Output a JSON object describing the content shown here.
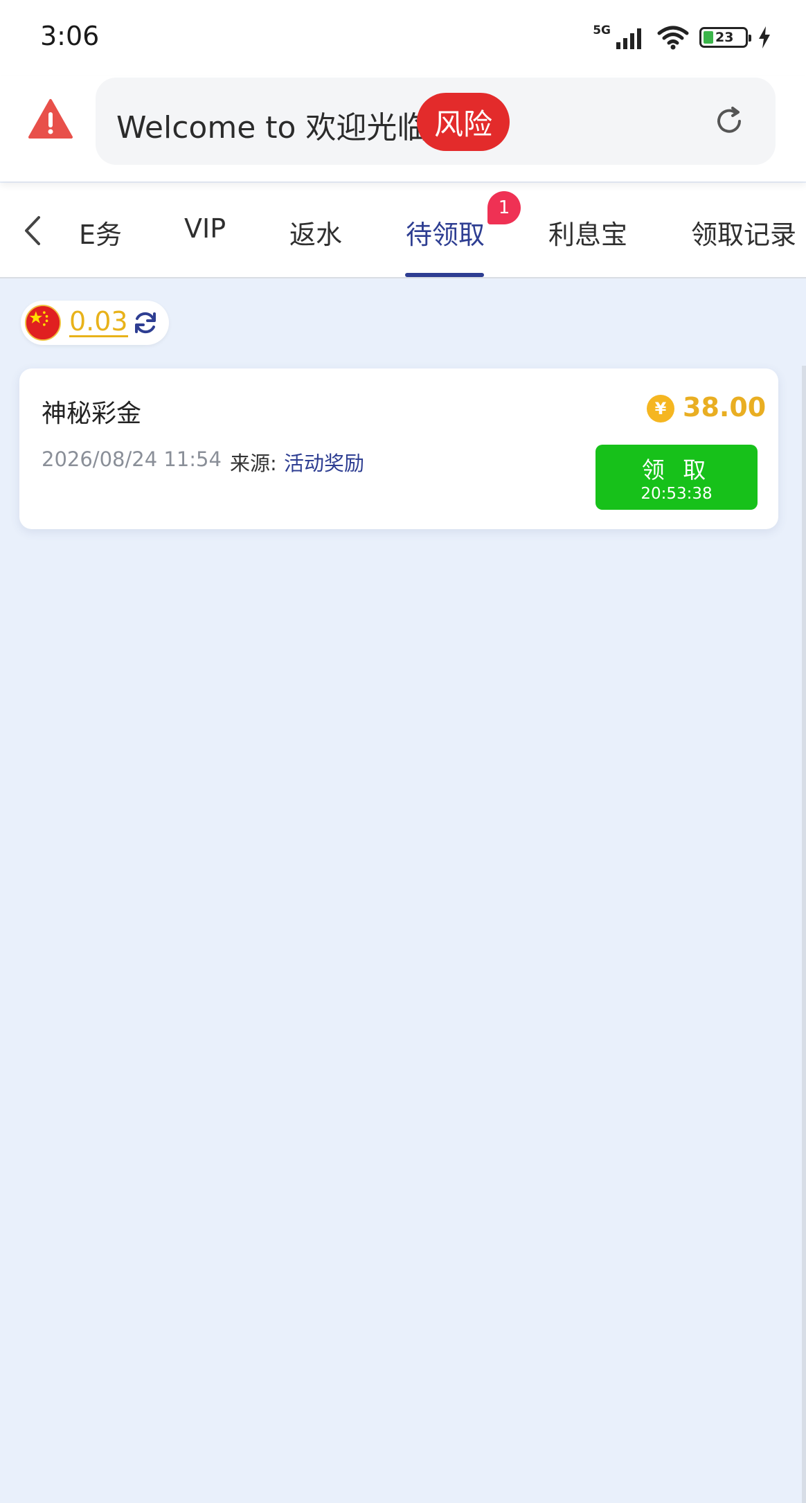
{
  "status_bar": {
    "time": "3:06",
    "network": "5G",
    "battery": "23",
    "icons": [
      "signal-icon",
      "wifi-icon",
      "battery-icon",
      "charging-icon"
    ]
  },
  "address_bar": {
    "url_text": "Welcome to 欢迎光临",
    "risk_label": "风险",
    "icons": [
      "warning-icon",
      "reload-icon"
    ],
    "colors": {
      "warning": "#e8504a",
      "risk_badge": "#e32b2b"
    }
  },
  "tabs": {
    "items": [
      {
        "label": "E务"
      },
      {
        "label": "VIP"
      },
      {
        "label": "返水"
      },
      {
        "label": "待领取",
        "active": true,
        "badge": "1"
      },
      {
        "label": "利息宝"
      },
      {
        "label": "领取记录"
      }
    ],
    "accent": "#2e3e92"
  },
  "balance": {
    "value": "0.03",
    "icons": [
      "china-flag-icon",
      "refresh-icon"
    ]
  },
  "reward_card": {
    "title": "神秘彩金",
    "date": "2026/08/24 11:54",
    "source_label": "来源:",
    "source_value": "活动奖励",
    "amount": "38.00",
    "currency_icon": "¥",
    "claim_label": "领 取",
    "countdown": "20:53:38",
    "colors": {
      "amount": "#e9ae22",
      "button": "#17c11a"
    }
  }
}
